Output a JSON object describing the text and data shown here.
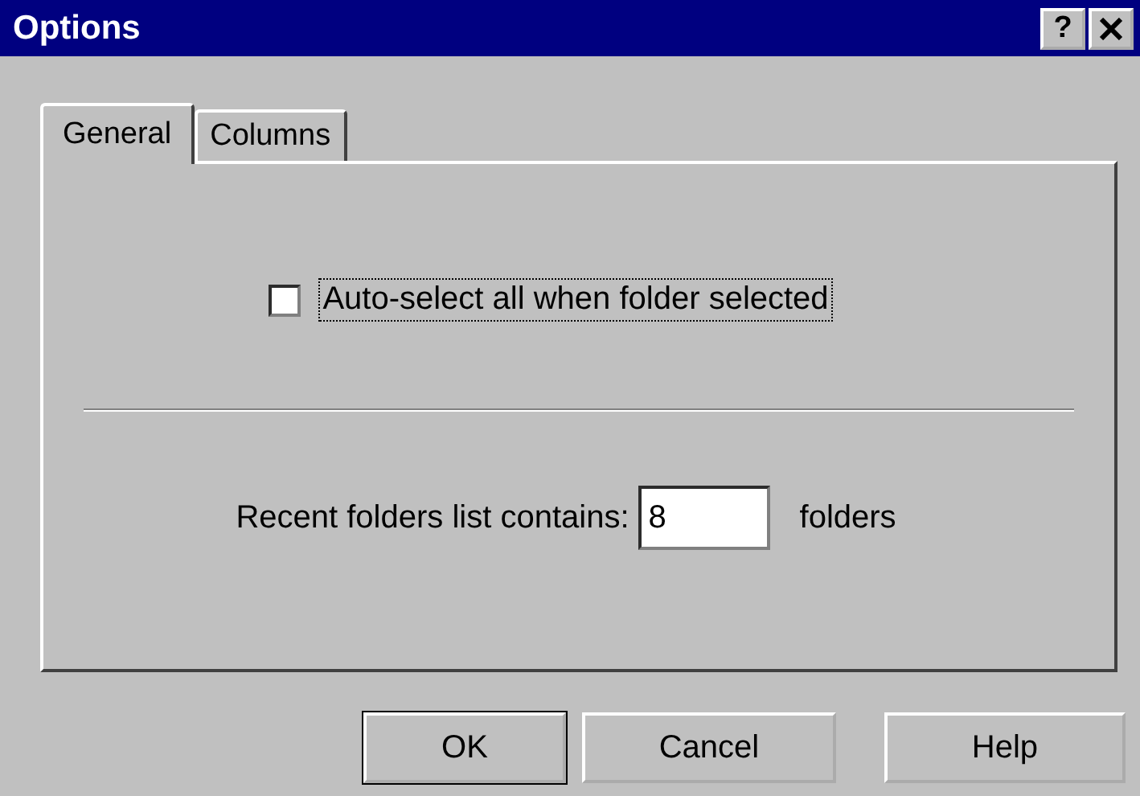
{
  "window": {
    "title": "Options",
    "help_button": "?"
  },
  "tabs": [
    {
      "label": "General",
      "selected": true
    },
    {
      "label": "Columns",
      "selected": false
    }
  ],
  "auto_select": {
    "label": "Auto-select all when folder selected",
    "checked": false,
    "focused": true
  },
  "recent_folders": {
    "label": "Recent folders list contains:",
    "value": "8",
    "unit": "folders"
  },
  "buttons": [
    {
      "label": "OK",
      "default": true
    },
    {
      "label": "Cancel",
      "default": false
    },
    {
      "label": "Help",
      "default": false
    }
  ]
}
